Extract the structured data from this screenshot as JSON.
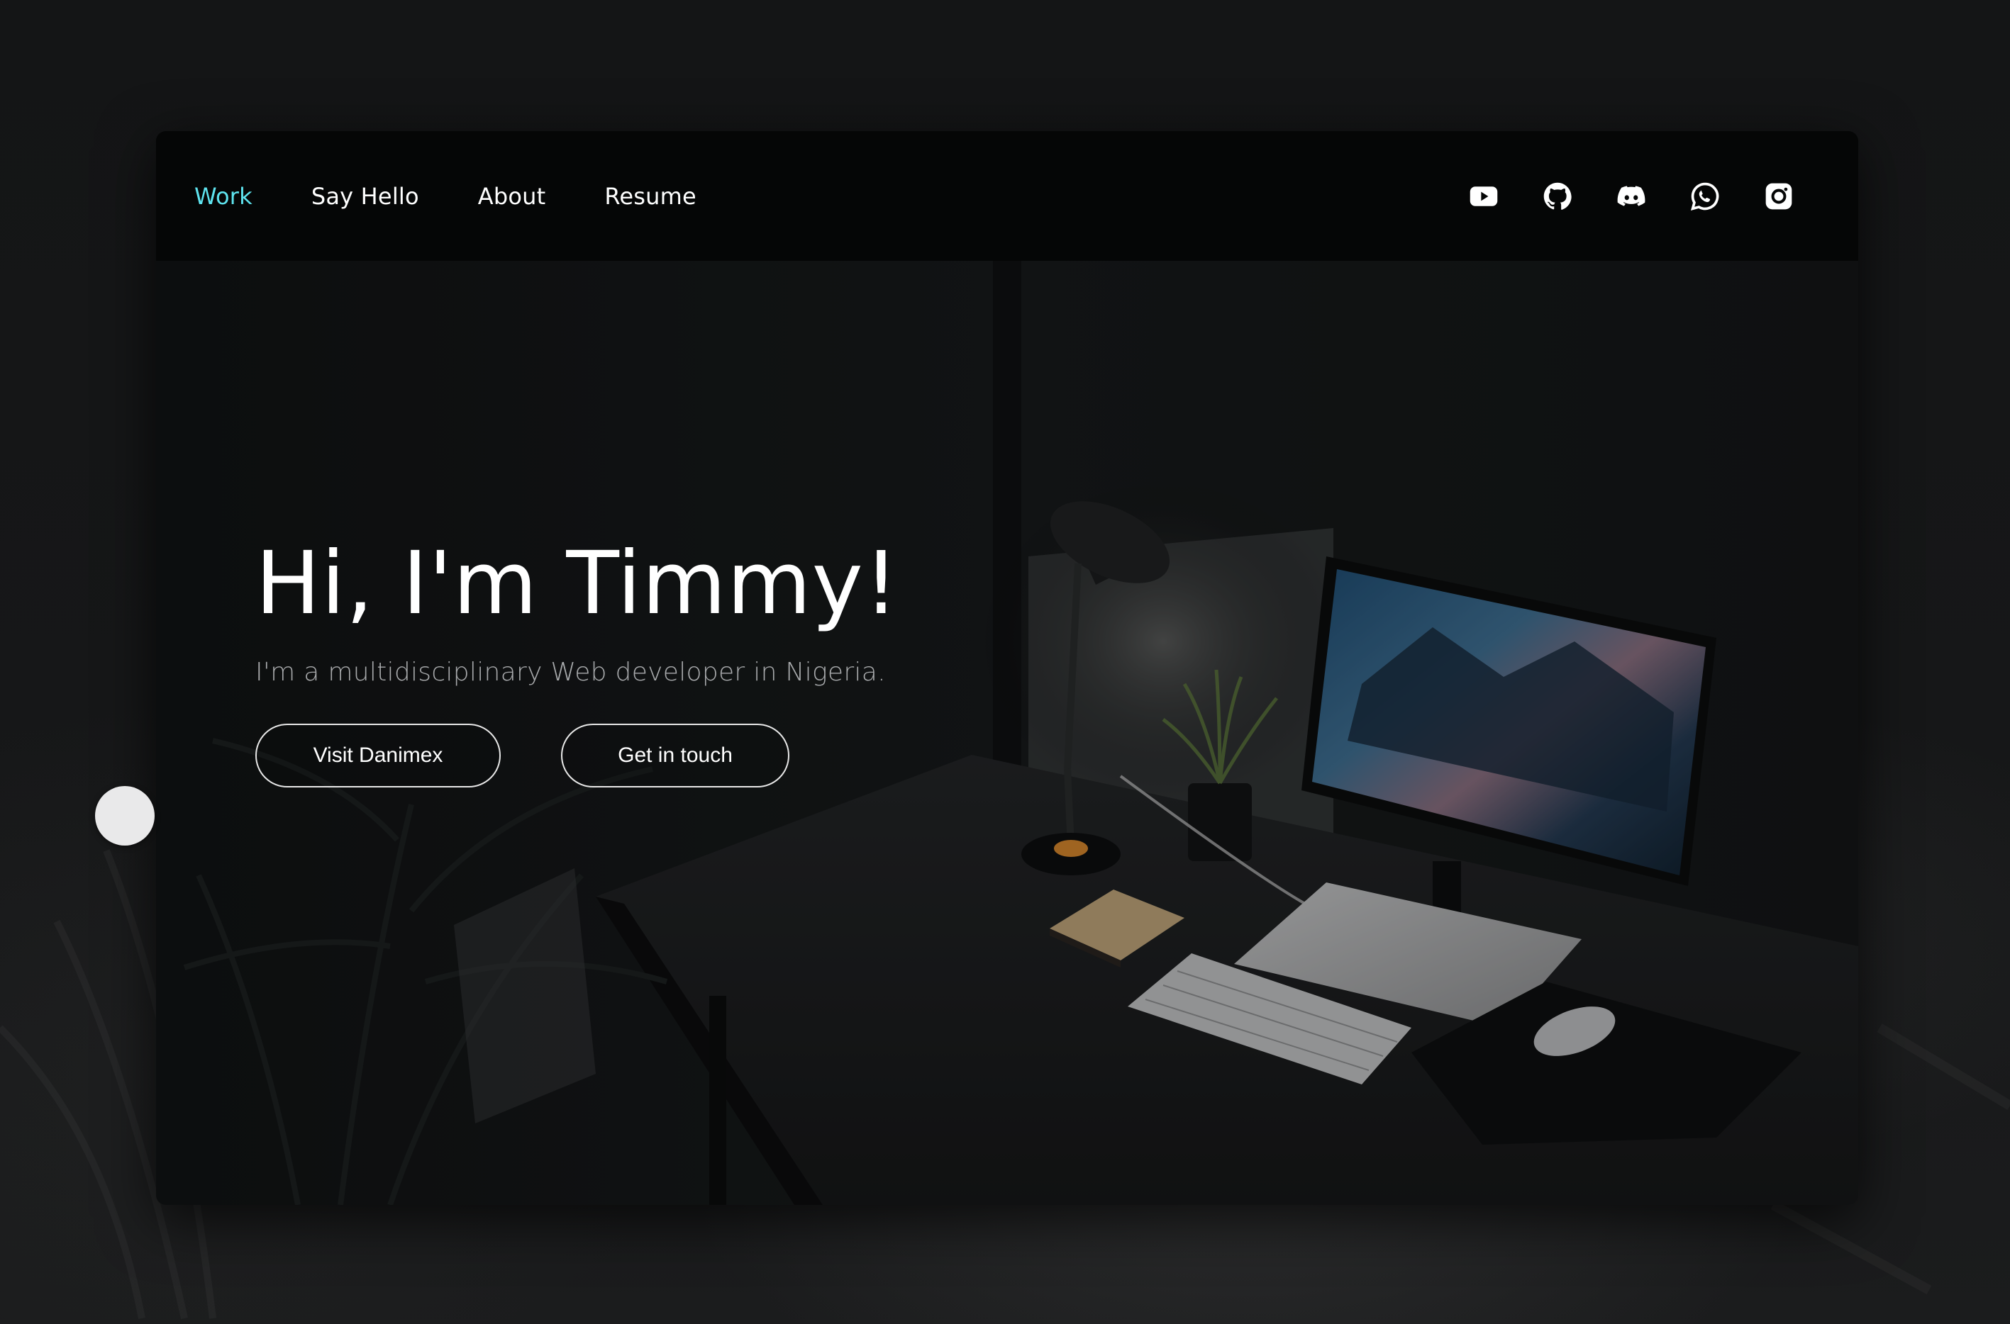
{
  "nav": {
    "links": [
      {
        "label": "Work",
        "active": true
      },
      {
        "label": "Say Hello",
        "active": false
      },
      {
        "label": "About",
        "active": false
      },
      {
        "label": "Resume",
        "active": false
      }
    ],
    "social_icons": [
      "youtube-icon",
      "github-icon",
      "discord-icon",
      "whatsapp-icon",
      "instagram-icon"
    ]
  },
  "hero": {
    "title": "Hi, I'm Timmy!",
    "subtitle": "I'm a multidisciplinary Web developer in Nigeria.",
    "buttons": {
      "visit": "Visit Danimex",
      "contact": "Get in touch"
    }
  },
  "colors": {
    "accent": "#5ee3ee",
    "navbar": "#050606",
    "text": "#ffffff",
    "subtitle": "#a9abad"
  }
}
